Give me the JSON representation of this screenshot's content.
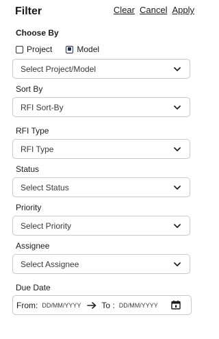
{
  "header": {
    "title": "Filter",
    "clear_label": "Clear",
    "cancel_label": "Cancel",
    "apply_label": "Apply"
  },
  "choose_by": {
    "label": "Choose By",
    "options": [
      {
        "label": "Project",
        "checked": false
      },
      {
        "label": "Model",
        "checked": true
      }
    ],
    "select_placeholder": "Select Project/Model"
  },
  "sort_by": {
    "label": "Sort By",
    "value": "RFI Sort-By"
  },
  "rfi_type": {
    "label": "RFI Type",
    "value": "RFI Type"
  },
  "status": {
    "label": "Status",
    "value": "Select Status"
  },
  "priority": {
    "label": "Priority",
    "value": "Select Priority"
  },
  "assignee": {
    "label": "Assignee",
    "value": "Select Assignee"
  },
  "due_date": {
    "label": "Due Date",
    "from_label": "From:",
    "from_placeholder": "DD/MM/YYYY",
    "to_label": "To :",
    "to_placeholder": "DD/MM/YYYY"
  },
  "icons": {
    "chevron": "chevron-down-icon",
    "arrow": "arrow-right-icon",
    "calendar": "calendar-icon"
  },
  "colors": {
    "accent": "#1d2b55",
    "border": "#c9c9c9"
  }
}
